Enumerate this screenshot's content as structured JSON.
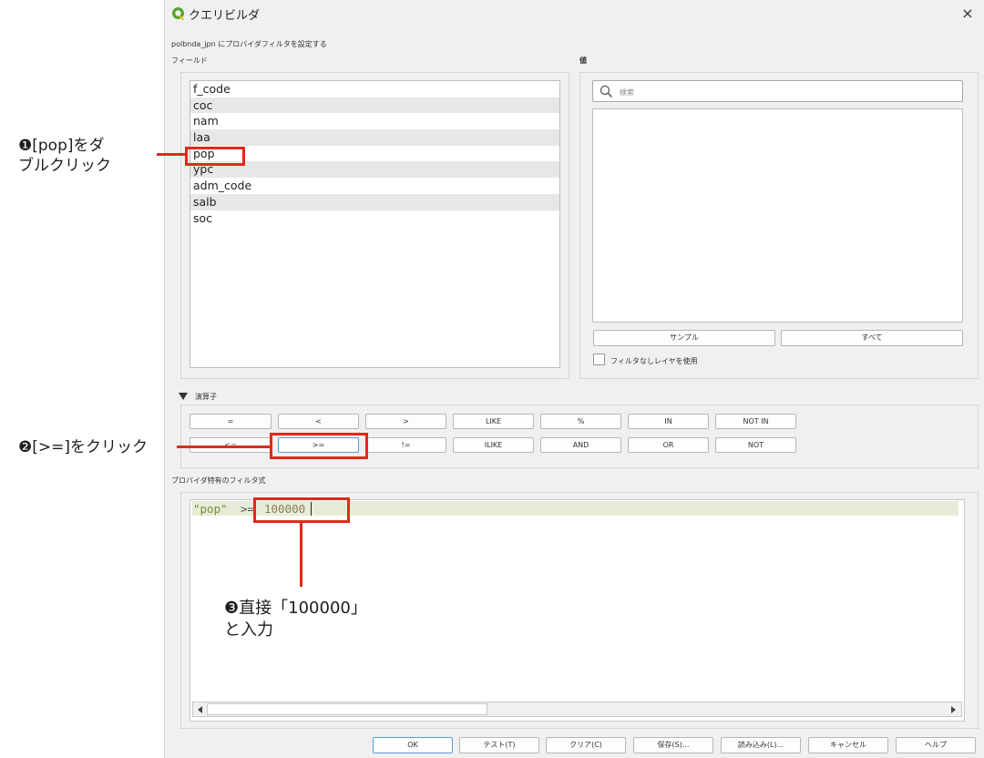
{
  "window": {
    "title": "クエリビルダ",
    "close_glyph": "×",
    "subtitle": "polbnda_jpn にプロバイダフィルタを設定する"
  },
  "fields_section": {
    "label": "フィールド",
    "items": [
      "f_code",
      "coc",
      "nam",
      "laa",
      "pop",
      "ypc",
      "adm_code",
      "salb",
      "soc"
    ]
  },
  "values_section": {
    "label": "値",
    "search_placeholder": "検索",
    "sample_button": "サンプル",
    "all_button": "すべて",
    "unfiltered_checkbox_label": "フィルタなしレイヤを使用"
  },
  "operators": {
    "label": "演算子",
    "row1": [
      "=",
      "<",
      ">",
      "LIKE",
      "%",
      "IN",
      "NOT IN"
    ],
    "row2": [
      "<=",
      ">=",
      "!=",
      "ILIKE",
      "AND",
      "OR",
      "NOT"
    ]
  },
  "expression": {
    "label": "プロバイダ特有のフィルタ式",
    "field_token": "\"pop\"",
    "operator_token": ">=",
    "value_token": "100000"
  },
  "footer": {
    "ok": "OK",
    "test": "テスト(T)",
    "clear": "クリア(C)",
    "save": "保存(S)...",
    "load": "読み込み(L)...",
    "cancel": "キャンセル",
    "help": "ヘルプ"
  },
  "annotations": {
    "step1_line1": "❶[pop]をダ",
    "step1_line2": "ブルクリック",
    "step2": "❷[>=]をクリック",
    "step3_line1": "❸直接「100000」",
    "step3_line2": "と入力"
  },
  "colors": {
    "annotation_red": "#e02a1b",
    "code_string": "#7a8b3a",
    "code_operator": "#555555",
    "code_number": "#8d7a55",
    "selection_bg": "#e6ecd8"
  },
  "icons": {
    "logo": "qgis-logo-icon",
    "close": "close-icon",
    "search": "search-icon",
    "collapse": "triangle-down-icon",
    "scroll_left": "arrow-left-icon",
    "scroll_right": "arrow-right-icon"
  }
}
